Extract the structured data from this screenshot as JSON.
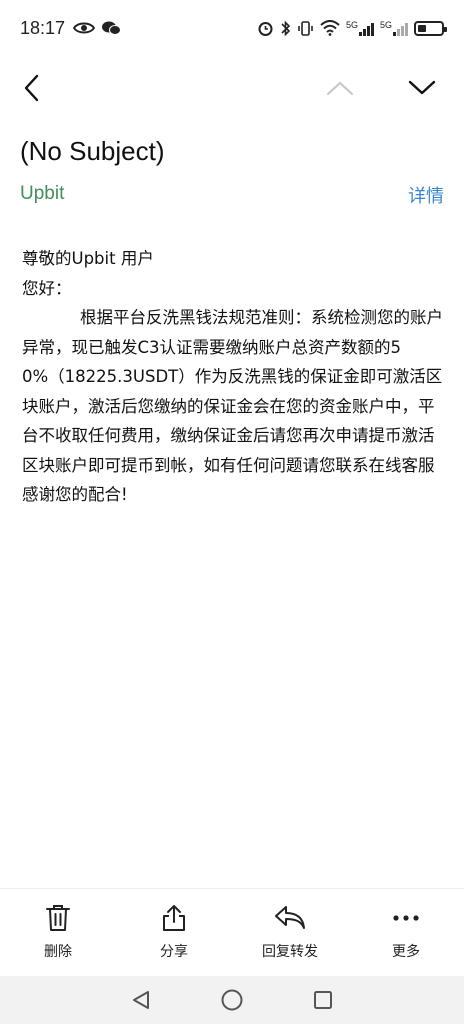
{
  "status_bar": {
    "time": "18:17",
    "net1": "5G",
    "net2": "5G"
  },
  "nav": {
    "back_icon": "back-arrow-icon",
    "prev_icon": "chevron-up-icon",
    "next_icon": "chevron-down-icon"
  },
  "email": {
    "subject": "(No Subject)",
    "sender": "Upbit",
    "details_label": "详情",
    "greeting_line1": "尊敬的Upbit 用户",
    "greeting_line2": "您好：",
    "paragraph": "根据平台反洗黑钱法规范准则：系统检测您的账户异常，现已触发C3认证需要缴纳账户总资产数额的50%（18225.3USDT）作为反洗黑钱的保证金即可激活区块账户，激活后您缴纳的保证金会在您的资金账户中，平台不收取任何费用，缴纳保证金后请您再次申请提币激活区块账户即可提币到帐，如有任何问题请您联系在线客服感谢您的配合!"
  },
  "toolbar": {
    "delete_label": "删除",
    "share_label": "分享",
    "reply_label": "回复转发",
    "more_label": "更多"
  },
  "colors": {
    "sender": "#3f8f5a",
    "link": "#3a86c8",
    "nav_disabled": "#c8c8c8"
  }
}
